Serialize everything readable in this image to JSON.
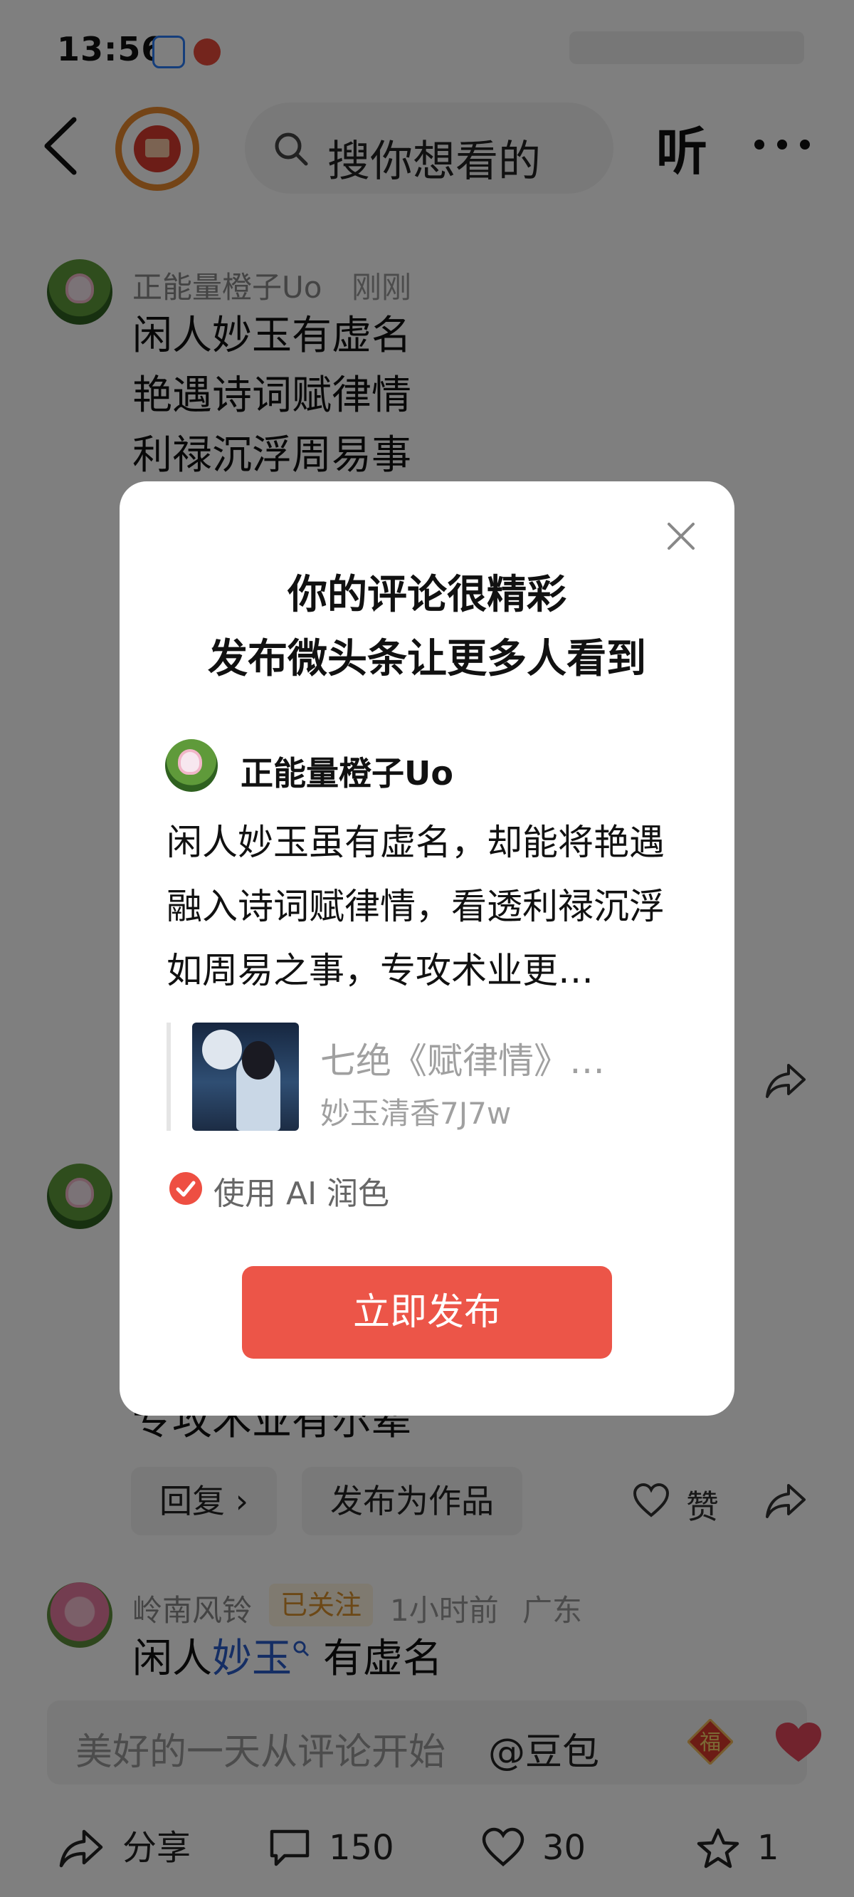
{
  "status_bar": {
    "time": "13:56"
  },
  "nav": {
    "search_placeholder": "搜你想看的",
    "listen_label": "听"
  },
  "comments": [
    {
      "author": "正能量橙子Uo",
      "time": "刚刚",
      "lines": [
        "闲人妙玉有虚名",
        "艳遇诗词赋律情",
        "利禄沉浮周易事"
      ]
    },
    {
      "partial_line": "专攻术业有尔辈",
      "reply_label": "回复 ›",
      "publish_as_work_label": "发布为作品",
      "like_label": "赞"
    },
    {
      "author": "岭南风铃",
      "badge": "已关注",
      "time": "1小时前",
      "location": "广东",
      "text_before": "闲人",
      "text_link": "妙玉",
      "text_after": "有虚名"
    }
  ],
  "composer": {
    "placeholder": "美好的一天从评论开始",
    "at_label": "@豆包",
    "fu_char": "福"
  },
  "bottom_bar": {
    "share_label": "分享",
    "comment_count": "150",
    "like_count": "30",
    "favorite_count": "1"
  },
  "dialog": {
    "title_line1": "你的评论很精彩",
    "title_line2": "发布微头条让更多人看到",
    "author": "正能量橙子Uo",
    "body": "闲人妙玉虽有虚名，却能将艳遇融入诗词赋律情，看透利禄沉浮如周易之事，专攻术业更…",
    "quote_title": "七绝《赋律情》…",
    "quote_author": "妙玉清香7J7w",
    "ai_option_label": "使用 AI 润色",
    "publish_label": "立即发布"
  },
  "colors": {
    "accent_red": "#ec5548",
    "followed_badge_text": "#d9912c",
    "link_blue": "#2b5cc8",
    "overlay": "rgba(0,0,0,0.5)"
  }
}
